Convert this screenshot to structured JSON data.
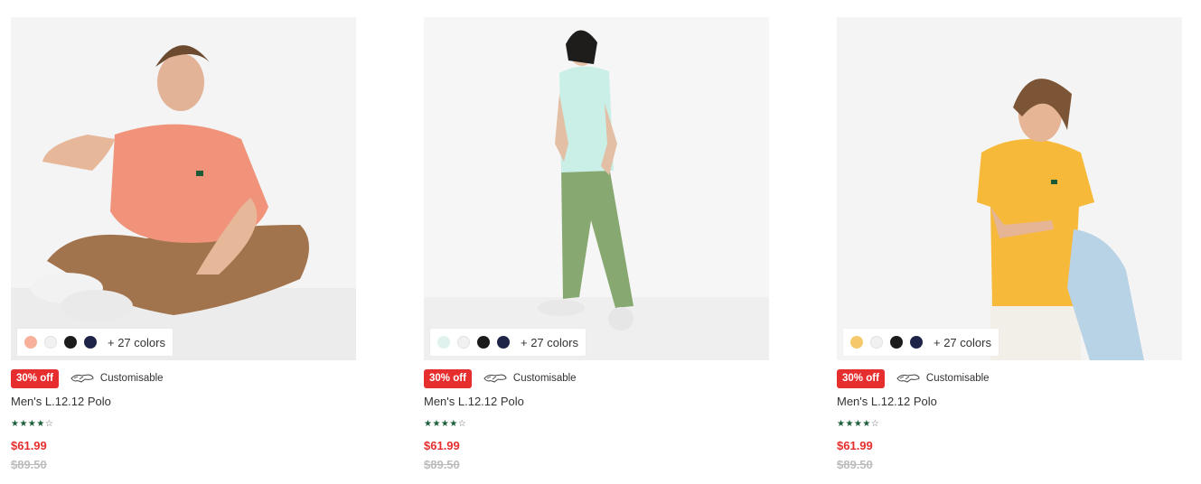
{
  "products": [
    {
      "name": "Men's L.12.12 Polo",
      "discount_badge": "30% off",
      "customisable_label": "Customisable",
      "more_colors": "+ 27 colors",
      "swatches": [
        "#f7b09a",
        "#f1f1f1",
        "#1b1b1b",
        "#1e2447"
      ],
      "rating_stars": "★★★★",
      "rating_empty": "☆",
      "price": "$61.99",
      "original_price": "$89.50"
    },
    {
      "name": "Men's L.12.12 Polo",
      "discount_badge": "30% off",
      "customisable_label": "Customisable",
      "more_colors": "+ 27 colors",
      "swatches": [
        "#dff2ee",
        "#f1f1f1",
        "#1b1b1b",
        "#1e2447"
      ],
      "rating_stars": "★★★★",
      "rating_empty": "☆",
      "price": "$61.99",
      "original_price": "$89.50"
    },
    {
      "name": "Men's L.12.12 Polo",
      "discount_badge": "30% off",
      "customisable_label": "Customisable",
      "more_colors": "+ 27 colors",
      "swatches": [
        "#f5c96b",
        "#f1f1f1",
        "#1b1b1b",
        "#1e2447"
      ],
      "rating_stars": "★★★★",
      "rating_empty": "☆",
      "price": "$61.99",
      "original_price": "$89.50"
    }
  ],
  "colors": {
    "badge": "#e62e2e",
    "price": "#e62e2e",
    "star": "#1a5e3a",
    "old_price": "#bcbcbc"
  },
  "icons": {
    "customisable": "crocodile-icon"
  }
}
